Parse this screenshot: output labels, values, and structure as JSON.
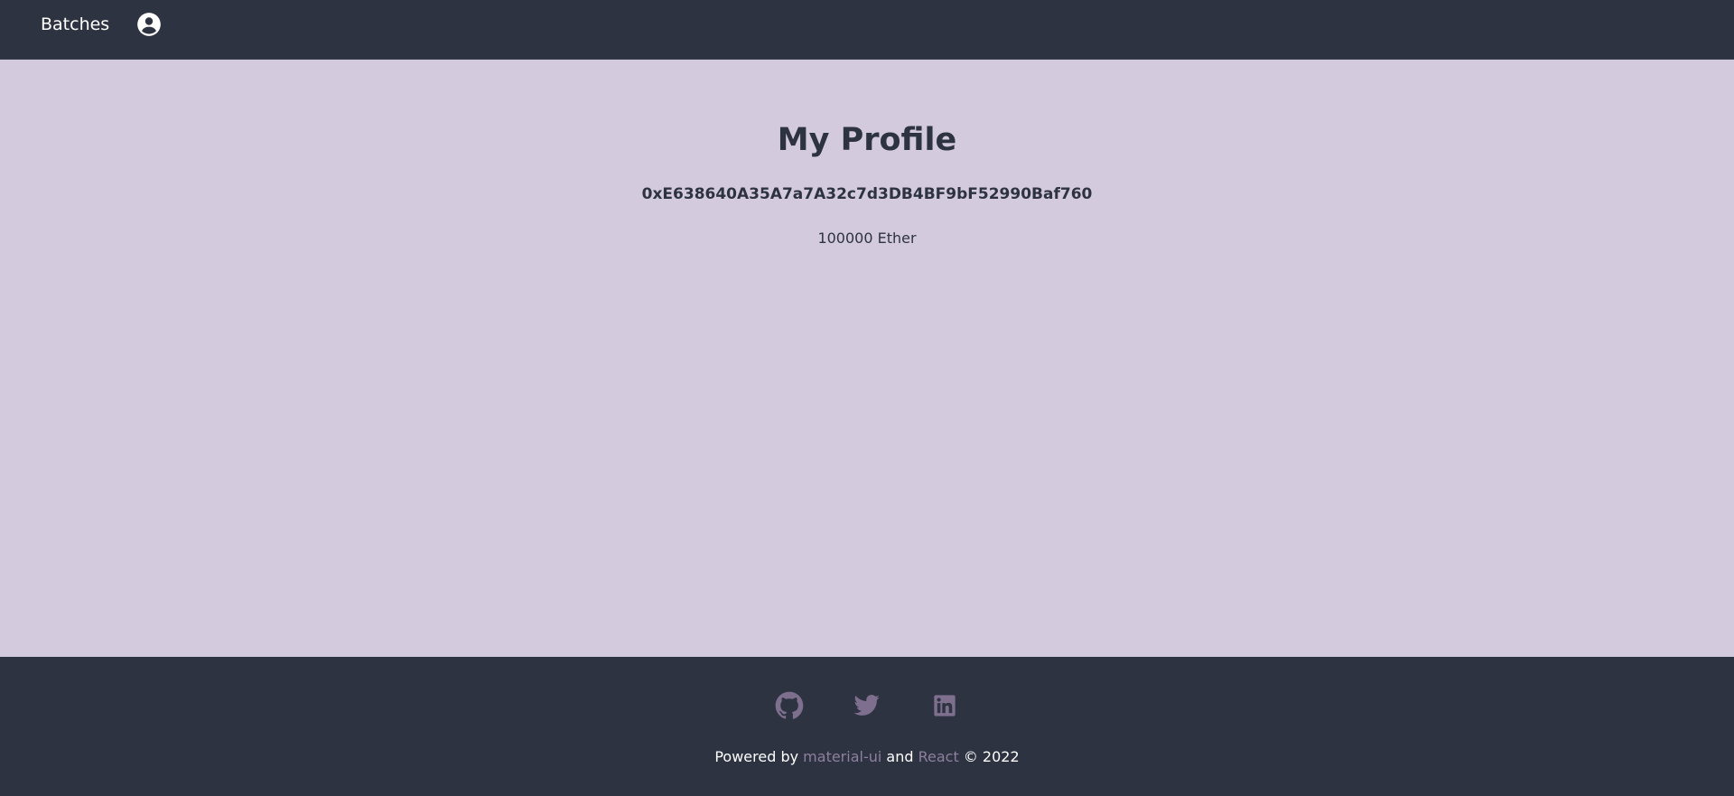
{
  "navbar": {
    "batches_label": "Batches",
    "profile_icon": "account-circle-icon"
  },
  "profile": {
    "title": "My Profile",
    "address": "0xE638640A35A7a7A32c7d3DB4BF9bF52990Baf760",
    "balance": "100000 Ether"
  },
  "footer": {
    "social_icons": [
      "github-icon",
      "twitter-icon",
      "linkedin-icon"
    ],
    "powered_prefix": "Powered by",
    "link1": "material-ui",
    "middle": "and",
    "link2": "React",
    "suffix": "© 2022"
  },
  "colors": {
    "header_bg": "#2d3341",
    "page_bg": "#d4cadd",
    "text_dark": "#2d3341",
    "link_muted": "#8e7f9d",
    "icon_muted": "#7e6f8f"
  }
}
